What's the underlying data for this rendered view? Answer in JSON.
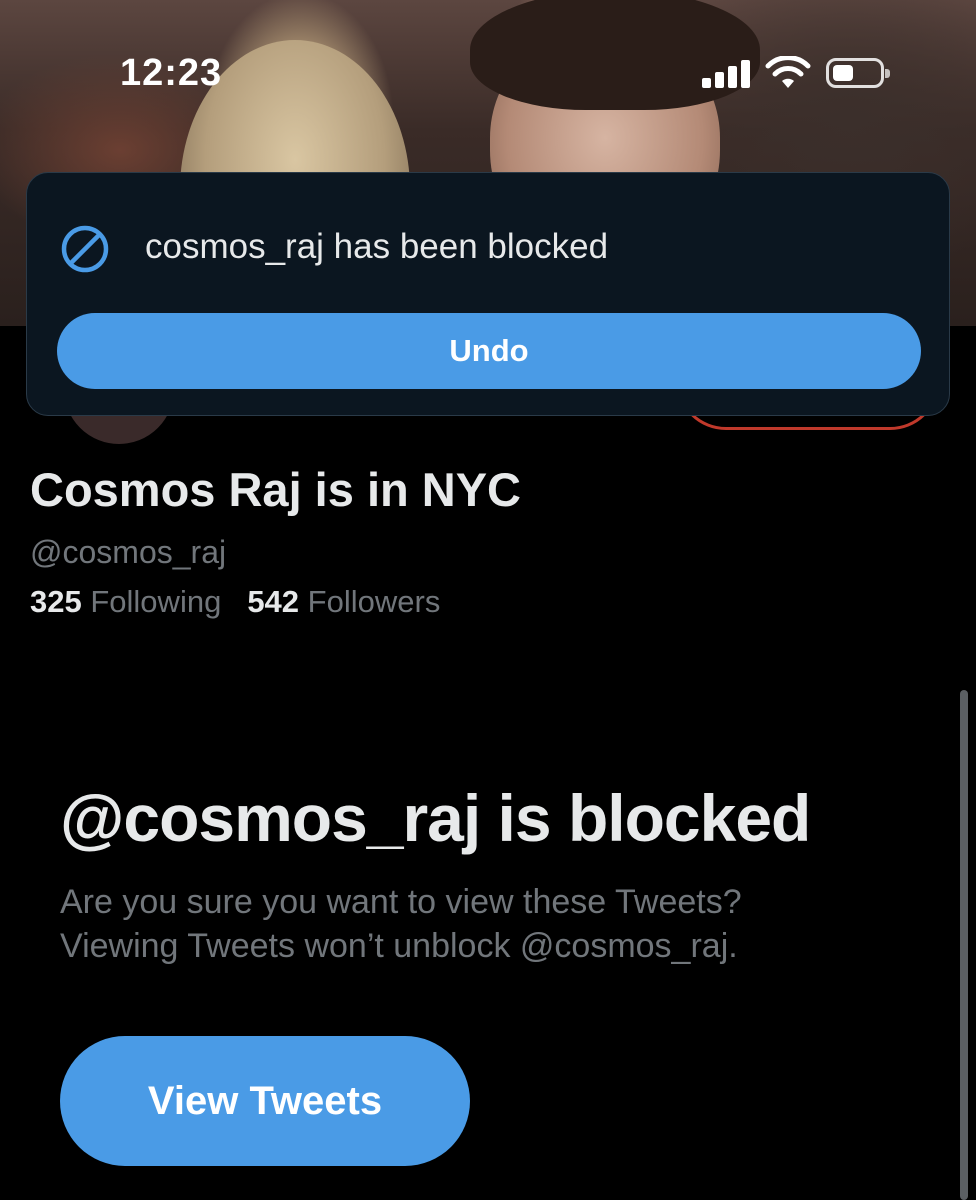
{
  "status_bar": {
    "time": "12:23"
  },
  "toast": {
    "message": "cosmos_raj has been blocked",
    "undo_label": "Undo",
    "icon": "block-icon"
  },
  "profile": {
    "display_name": "Cosmos Raj is in NYC",
    "handle": "@cosmos_raj",
    "following_count": "325",
    "following_label": "Following",
    "followers_count": "542",
    "followers_label": "Followers"
  },
  "blocked_notice": {
    "title": "@cosmos_raj is blocked",
    "line1": "Are you sure you want to view these Tweets?",
    "line2": "Viewing Tweets won’t unblock @cosmos_raj.",
    "view_button_label": "View Tweets"
  },
  "colors": {
    "accent": "#4a9be6",
    "background": "#000000",
    "muted_text": "#71767b"
  }
}
